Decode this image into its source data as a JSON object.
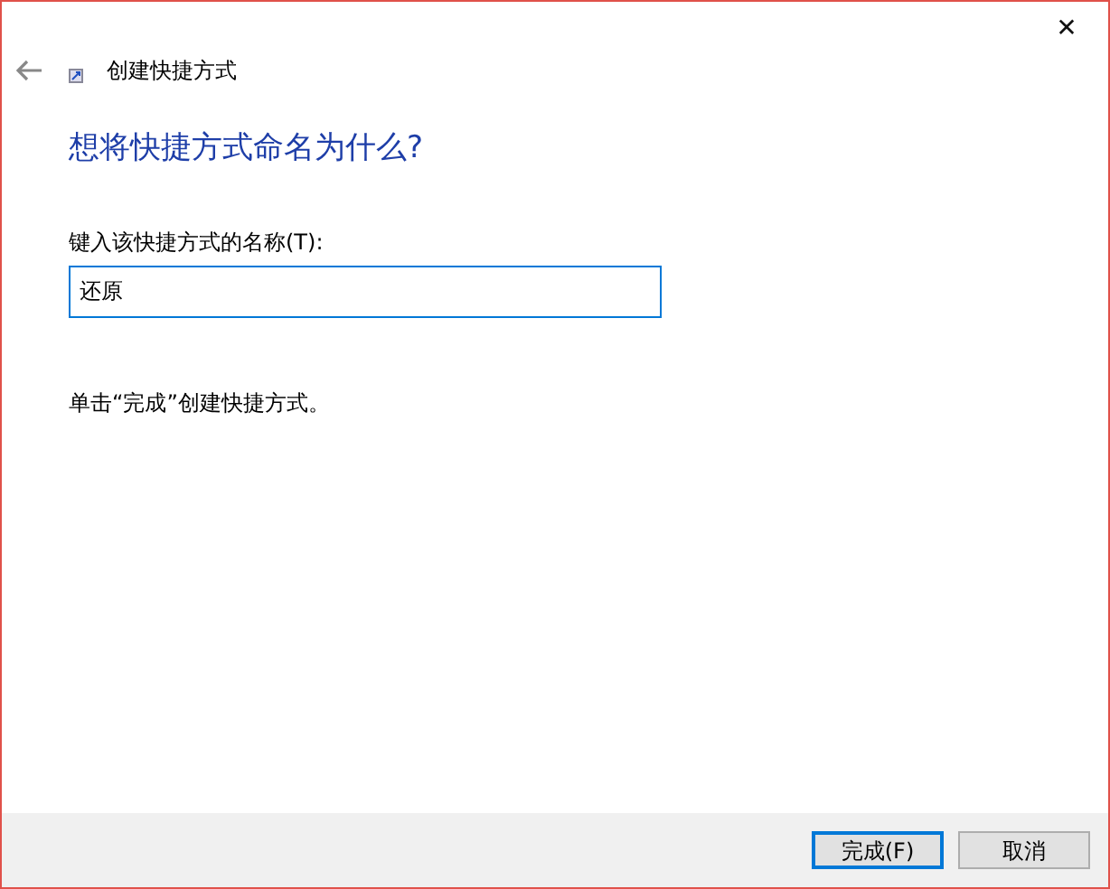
{
  "window": {
    "title": "创建快捷方式",
    "close": "✕"
  },
  "heading": "想将快捷方式命名为什么?",
  "name_field": {
    "label": "键入该快捷方式的名称(T):",
    "value": "还原",
    "focused": true
  },
  "instruction": "单击“完成”创建快捷方式。",
  "buttons": [
    {
      "label": "完成(F)",
      "default": true
    },
    {
      "label": "取消",
      "default": false
    }
  ]
}
